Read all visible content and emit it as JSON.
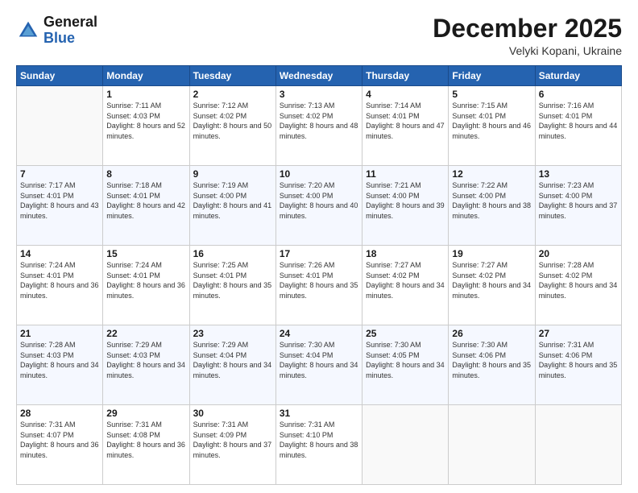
{
  "header": {
    "logo_line1": "General",
    "logo_line2": "Blue",
    "month": "December 2025",
    "location": "Velyki Kopani, Ukraine"
  },
  "weekdays": [
    "Sunday",
    "Monday",
    "Tuesday",
    "Wednesday",
    "Thursday",
    "Friday",
    "Saturday"
  ],
  "weeks": [
    [
      {
        "day": "",
        "sunrise": "",
        "sunset": "",
        "daylight": ""
      },
      {
        "day": "1",
        "sunrise": "7:11 AM",
        "sunset": "4:03 PM",
        "daylight": "8 hours and 52 minutes."
      },
      {
        "day": "2",
        "sunrise": "7:12 AM",
        "sunset": "4:02 PM",
        "daylight": "8 hours and 50 minutes."
      },
      {
        "day": "3",
        "sunrise": "7:13 AM",
        "sunset": "4:02 PM",
        "daylight": "8 hours and 48 minutes."
      },
      {
        "day": "4",
        "sunrise": "7:14 AM",
        "sunset": "4:01 PM",
        "daylight": "8 hours and 47 minutes."
      },
      {
        "day": "5",
        "sunrise": "7:15 AM",
        "sunset": "4:01 PM",
        "daylight": "8 hours and 46 minutes."
      },
      {
        "day": "6",
        "sunrise": "7:16 AM",
        "sunset": "4:01 PM",
        "daylight": "8 hours and 44 minutes."
      }
    ],
    [
      {
        "day": "7",
        "sunrise": "7:17 AM",
        "sunset": "4:01 PM",
        "daylight": "8 hours and 43 minutes."
      },
      {
        "day": "8",
        "sunrise": "7:18 AM",
        "sunset": "4:01 PM",
        "daylight": "8 hours and 42 minutes."
      },
      {
        "day": "9",
        "sunrise": "7:19 AM",
        "sunset": "4:00 PM",
        "daylight": "8 hours and 41 minutes."
      },
      {
        "day": "10",
        "sunrise": "7:20 AM",
        "sunset": "4:00 PM",
        "daylight": "8 hours and 40 minutes."
      },
      {
        "day": "11",
        "sunrise": "7:21 AM",
        "sunset": "4:00 PM",
        "daylight": "8 hours and 39 minutes."
      },
      {
        "day": "12",
        "sunrise": "7:22 AM",
        "sunset": "4:00 PM",
        "daylight": "8 hours and 38 minutes."
      },
      {
        "day": "13",
        "sunrise": "7:23 AM",
        "sunset": "4:00 PM",
        "daylight": "8 hours and 37 minutes."
      }
    ],
    [
      {
        "day": "14",
        "sunrise": "7:24 AM",
        "sunset": "4:01 PM",
        "daylight": "8 hours and 36 minutes."
      },
      {
        "day": "15",
        "sunrise": "7:24 AM",
        "sunset": "4:01 PM",
        "daylight": "8 hours and 36 minutes."
      },
      {
        "day": "16",
        "sunrise": "7:25 AM",
        "sunset": "4:01 PM",
        "daylight": "8 hours and 35 minutes."
      },
      {
        "day": "17",
        "sunrise": "7:26 AM",
        "sunset": "4:01 PM",
        "daylight": "8 hours and 35 minutes."
      },
      {
        "day": "18",
        "sunrise": "7:27 AM",
        "sunset": "4:02 PM",
        "daylight": "8 hours and 34 minutes."
      },
      {
        "day": "19",
        "sunrise": "7:27 AM",
        "sunset": "4:02 PM",
        "daylight": "8 hours and 34 minutes."
      },
      {
        "day": "20",
        "sunrise": "7:28 AM",
        "sunset": "4:02 PM",
        "daylight": "8 hours and 34 minutes."
      }
    ],
    [
      {
        "day": "21",
        "sunrise": "7:28 AM",
        "sunset": "4:03 PM",
        "daylight": "8 hours and 34 minutes."
      },
      {
        "day": "22",
        "sunrise": "7:29 AM",
        "sunset": "4:03 PM",
        "daylight": "8 hours and 34 minutes."
      },
      {
        "day": "23",
        "sunrise": "7:29 AM",
        "sunset": "4:04 PM",
        "daylight": "8 hours and 34 minutes."
      },
      {
        "day": "24",
        "sunrise": "7:30 AM",
        "sunset": "4:04 PM",
        "daylight": "8 hours and 34 minutes."
      },
      {
        "day": "25",
        "sunrise": "7:30 AM",
        "sunset": "4:05 PM",
        "daylight": "8 hours and 34 minutes."
      },
      {
        "day": "26",
        "sunrise": "7:30 AM",
        "sunset": "4:06 PM",
        "daylight": "8 hours and 35 minutes."
      },
      {
        "day": "27",
        "sunrise": "7:31 AM",
        "sunset": "4:06 PM",
        "daylight": "8 hours and 35 minutes."
      }
    ],
    [
      {
        "day": "28",
        "sunrise": "7:31 AM",
        "sunset": "4:07 PM",
        "daylight": "8 hours and 36 minutes."
      },
      {
        "day": "29",
        "sunrise": "7:31 AM",
        "sunset": "4:08 PM",
        "daylight": "8 hours and 36 minutes."
      },
      {
        "day": "30",
        "sunrise": "7:31 AM",
        "sunset": "4:09 PM",
        "daylight": "8 hours and 37 minutes."
      },
      {
        "day": "31",
        "sunrise": "7:31 AM",
        "sunset": "4:10 PM",
        "daylight": "8 hours and 38 minutes."
      },
      {
        "day": "",
        "sunrise": "",
        "sunset": "",
        "daylight": ""
      },
      {
        "day": "",
        "sunrise": "",
        "sunset": "",
        "daylight": ""
      },
      {
        "day": "",
        "sunrise": "",
        "sunset": "",
        "daylight": ""
      }
    ]
  ]
}
